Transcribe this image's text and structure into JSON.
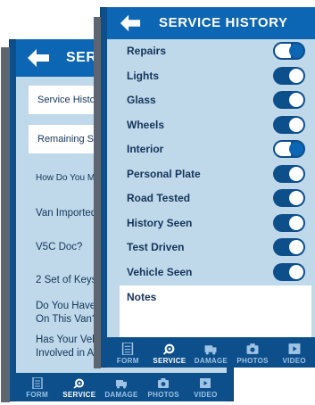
{
  "back_screen": {
    "title": "SERVICE",
    "fields": [
      {
        "label": "Service History?"
      },
      {
        "label": "Remaining Service"
      }
    ],
    "questions": [
      "How Do You Ma",
      "Van Imported",
      "V5C Doc?",
      "2 Set of Keys?",
      "Do You Have",
      "On This Van?",
      "Has Your Vehi",
      "Involved in A"
    ],
    "tabs": [
      {
        "label": "FORM",
        "icon": "form-icon"
      },
      {
        "label": "SERVICE",
        "icon": "service-icon"
      },
      {
        "label": "DAMAGE",
        "icon": "damage-icon"
      },
      {
        "label": "PHOTOS",
        "icon": "camera-icon"
      },
      {
        "label": "VIDEO",
        "icon": "video-icon"
      }
    ]
  },
  "front_screen": {
    "title": "SERVICE HISTORY",
    "toggles": [
      {
        "label": "Repairs",
        "on": true
      },
      {
        "label": "Lights",
        "on": true
      },
      {
        "label": "Glass",
        "on": true
      },
      {
        "label": "Wheels",
        "on": true
      },
      {
        "label": "Interior",
        "on": true
      },
      {
        "label": "Personal Plate",
        "on": true
      },
      {
        "label": "Road Tested",
        "on": true
      },
      {
        "label": "History Seen",
        "on": true
      },
      {
        "label": "Test Driven",
        "on": true
      },
      {
        "label": "Vehicle Seen",
        "on": true
      }
    ],
    "notes_label": "Notes",
    "tabs": [
      {
        "label": "FORM",
        "icon": "form-icon"
      },
      {
        "label": "SERVICE",
        "icon": "service-icon"
      },
      {
        "label": "DAMAGE",
        "icon": "damage-icon"
      },
      {
        "label": "PHOTOS",
        "icon": "camera-icon"
      },
      {
        "label": "VIDEO",
        "icon": "video-icon"
      }
    ]
  },
  "colors": {
    "header": "#0d66b3",
    "tabbar": "#0d4f8b",
    "screen_bg": "#bfd9ea",
    "text": "#14345a"
  }
}
